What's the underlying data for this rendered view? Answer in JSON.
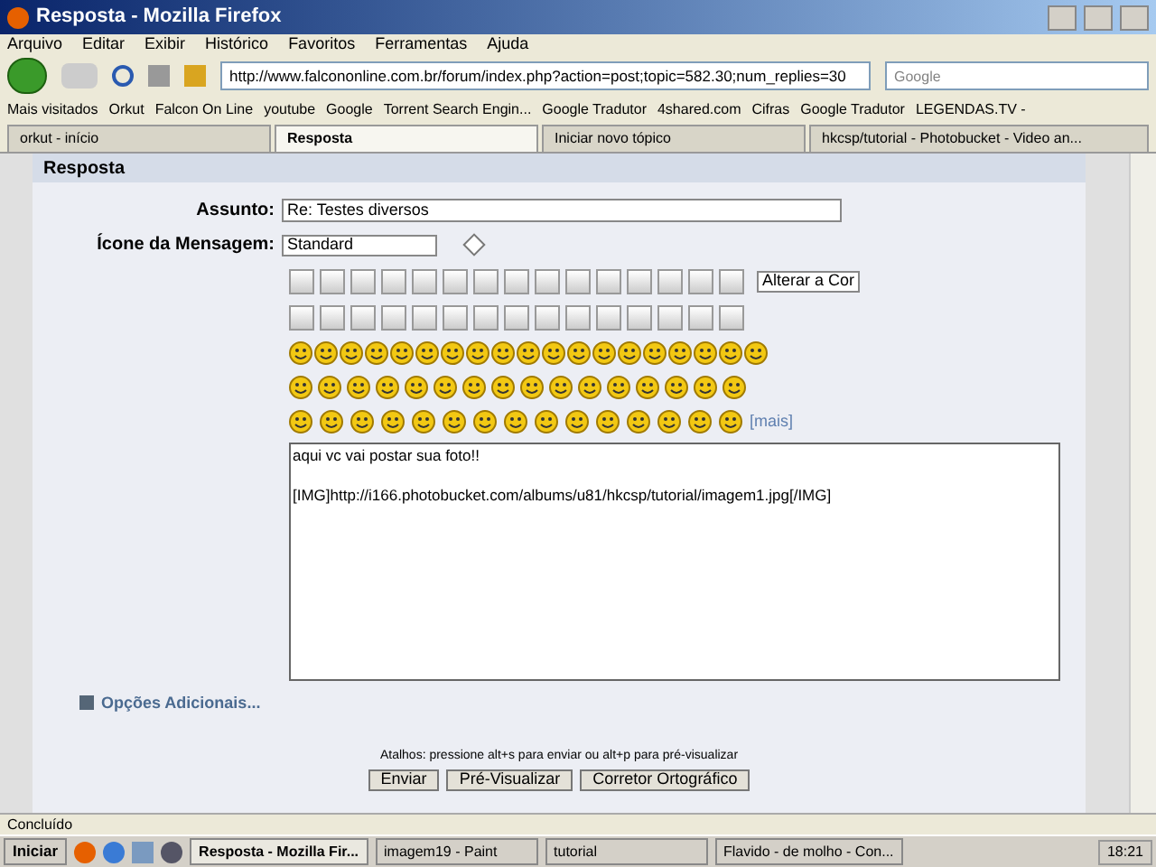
{
  "window": {
    "title": "Resposta - Mozilla Firefox"
  },
  "menu": [
    "Arquivo",
    "Editar",
    "Exibir",
    "Histórico",
    "Favoritos",
    "Ferramentas",
    "Ajuda"
  ],
  "address_bar": {
    "value": "http://www.falcononline.com.br/forum/index.php?action=post;topic=582.30;num_replies=30"
  },
  "search": {
    "placeholder": "Google"
  },
  "bookmarks": [
    "Mais visitados",
    "Orkut",
    "Falcon On Line",
    "youtube",
    "Google",
    "Torrent Search Engin...",
    "Google Tradutor",
    "4shared.com",
    "Cifras",
    "Google Tradutor",
    "LEGENDAS.TV -"
  ],
  "tabs": [
    {
      "label": "orkut - início",
      "selected": false
    },
    {
      "label": "Resposta",
      "selected": true
    },
    {
      "label": "Iniciar novo tópico",
      "selected": false
    },
    {
      "label": "hkcsp/tutorial - Photobucket - Video an...",
      "selected": false
    }
  ],
  "form": {
    "heading": "Resposta",
    "subject_label": "Assunto:",
    "subject_value": "Re: Testes diversos",
    "icon_label": "Ícone da Mensagem:",
    "icon_value": "Standard",
    "color_select": "Alterar a Cor",
    "more_link": "[mais]",
    "message_lines": [
      "aqui vc vai postar sua foto!!",
      "[IMG]http://i166.photobucket.com/albums/u81/hkcsp/tutorial/imagem1.jpg[/IMG]"
    ],
    "additional_options": "Opções Adicionais...",
    "shortcuts": "Atalhos: pressione alt+s para enviar ou alt+p para pré-visualizar",
    "buttons": [
      "Enviar",
      "Pré-Visualizar",
      "Corretor Ortográfico"
    ]
  },
  "status_bar": {
    "text": "Concluído"
  },
  "taskbar": {
    "start": "Iniciar",
    "items": [
      {
        "label": "Resposta - Mozilla Fir...",
        "selected": true
      },
      {
        "label": "imagem19 - Paint",
        "selected": false
      },
      {
        "label": "tutorial",
        "selected": false
      },
      {
        "label": "Flavido - de molho - Con...",
        "selected": false
      }
    ],
    "clock": "18:21"
  }
}
